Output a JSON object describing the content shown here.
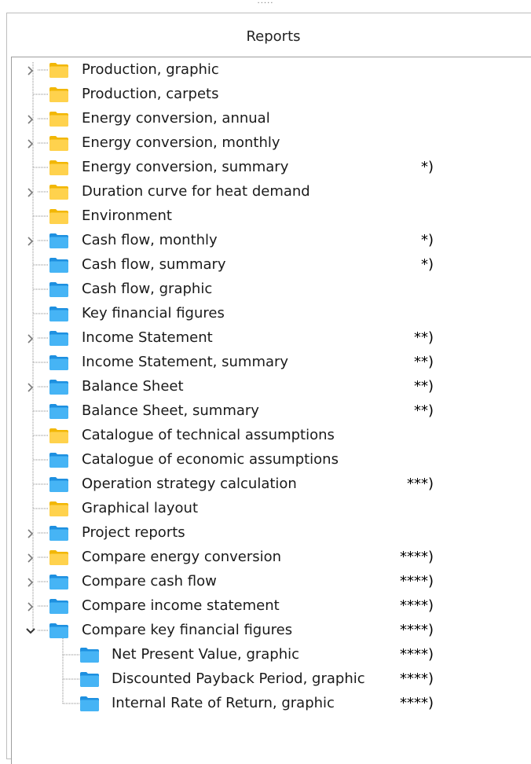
{
  "handle": "·····",
  "panel": {
    "title": "Reports"
  },
  "tree": {
    "items": [
      {
        "label": "Production, graphic",
        "color": "yellow",
        "expander": "collapsed",
        "note": ""
      },
      {
        "label": "Production, carpets",
        "color": "yellow",
        "expander": "none",
        "note": ""
      },
      {
        "label": "Energy conversion, annual",
        "color": "yellow",
        "expander": "collapsed",
        "note": ""
      },
      {
        "label": "Energy conversion, monthly",
        "color": "yellow",
        "expander": "collapsed",
        "note": ""
      },
      {
        "label": "Energy conversion, summary",
        "color": "yellow",
        "expander": "none",
        "note": "*)"
      },
      {
        "label": "Duration curve for heat demand",
        "color": "yellow",
        "expander": "collapsed",
        "note": ""
      },
      {
        "label": "Environment",
        "color": "yellow",
        "expander": "none",
        "note": ""
      },
      {
        "label": "Cash flow, monthly",
        "color": "blue",
        "expander": "collapsed",
        "note": "*)"
      },
      {
        "label": "Cash flow, summary",
        "color": "blue",
        "expander": "none",
        "note": "*)"
      },
      {
        "label": "Cash flow, graphic",
        "color": "blue",
        "expander": "none",
        "note": ""
      },
      {
        "label": "Key financial figures",
        "color": "blue",
        "expander": "none",
        "note": ""
      },
      {
        "label": "Income Statement",
        "color": "blue",
        "expander": "collapsed",
        "note": "**)"
      },
      {
        "label": "Income Statement, summary",
        "color": "blue",
        "expander": "none",
        "note": "**)"
      },
      {
        "label": "Balance Sheet",
        "color": "blue",
        "expander": "collapsed",
        "note": "**)"
      },
      {
        "label": "Balance Sheet, summary",
        "color": "blue",
        "expander": "none",
        "note": "**)"
      },
      {
        "label": "Catalogue of technical assumptions",
        "color": "yellow",
        "expander": "none",
        "note": ""
      },
      {
        "label": "Catalogue of economic assumptions",
        "color": "blue",
        "expander": "none",
        "note": ""
      },
      {
        "label": "Operation strategy calculation",
        "color": "blue",
        "expander": "none",
        "note": "***)"
      },
      {
        "label": "Graphical layout",
        "color": "yellow",
        "expander": "none",
        "note": ""
      },
      {
        "label": "Project reports",
        "color": "blue",
        "expander": "collapsed",
        "note": ""
      },
      {
        "label": "Compare energy conversion",
        "color": "yellow",
        "expander": "collapsed",
        "note": "****)"
      },
      {
        "label": "Compare cash flow",
        "color": "blue",
        "expander": "collapsed",
        "note": "****)"
      },
      {
        "label": "Compare income statement",
        "color": "blue",
        "expander": "collapsed",
        "note": "****)"
      },
      {
        "label": "Compare key financial figures",
        "color": "blue",
        "expander": "expanded",
        "note": "****)"
      }
    ],
    "children": [
      {
        "label": "Net Present Value, graphic",
        "color": "blue",
        "note": "****)"
      },
      {
        "label": "Discounted Payback Period, graphic",
        "color": "blue",
        "note": "****)"
      },
      {
        "label": "Internal Rate of Return, graphic",
        "color": "blue",
        "note": "****)"
      }
    ]
  },
  "colors": {
    "yellow_folder": "#f2b705",
    "yellow_folder_light": "#ffd24d",
    "blue_folder": "#1e90e0",
    "blue_folder_light": "#46b4f5",
    "connector": "#8a8a8a",
    "expander": "#7a7a7a"
  }
}
